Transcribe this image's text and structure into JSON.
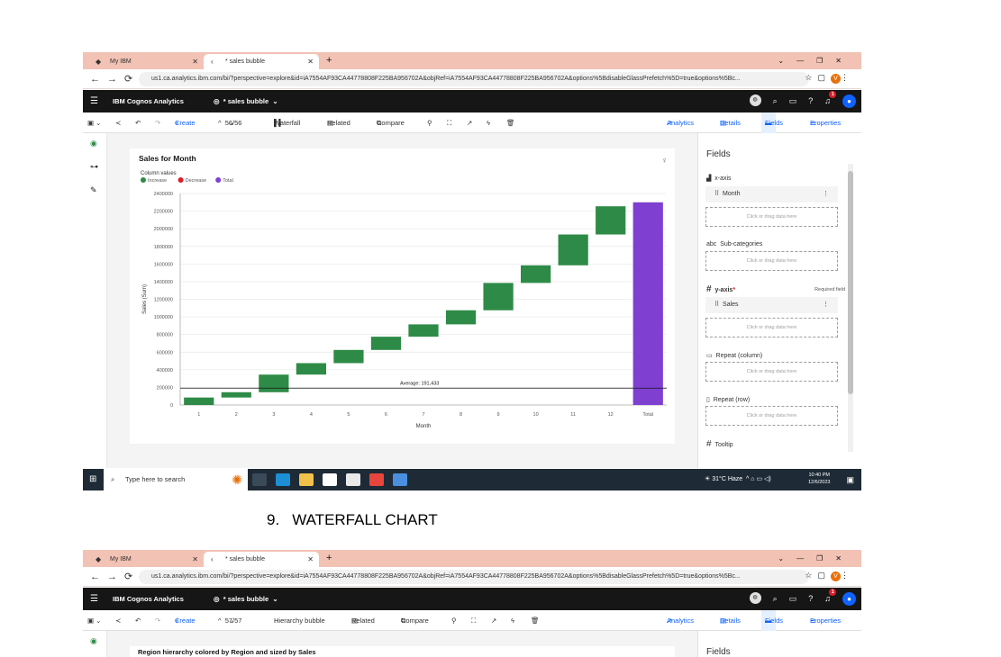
{
  "browser": {
    "tabs": [
      {
        "label": "My IBM"
      },
      {
        "label": "* sales bubble"
      }
    ],
    "url": "us1.ca.analytics.ibm.com/bi/?perspective=explore&id=iA7554AF93CA44778808F225BA956702A&objRef=iA7554AF93CA44778808F225BA956702A&options%5BdisableGlassPrefetch%5D=true&options%5Bc..."
  },
  "app": {
    "brand": "IBM Cognos Analytics",
    "report_title": "* sales bubble",
    "notification_count": "1",
    "avatar_initial": "V"
  },
  "toolbar1": {
    "create": "Create",
    "page": "56/56",
    "viz": "Waterfall",
    "related": "Related",
    "compare": "Compare",
    "analytics": "Analytics",
    "details": "Details",
    "fields": "Fields",
    "properties": "Properties"
  },
  "chart_card": {
    "title": "Sales for Month",
    "legend_title": "Column values",
    "legend": [
      {
        "label": "Increase",
        "color": "#2e8b47"
      },
      {
        "label": "Decrease",
        "color": "#da1e28"
      },
      {
        "label": "Total",
        "color": "#7f3fd1"
      }
    ],
    "average_label": "Average: 191,433"
  },
  "chart_data": {
    "type": "bar",
    "subtype": "waterfall",
    "title": "Sales for Month",
    "xlabel": "Month",
    "ylabel": "Sales (Sum)",
    "categories": [
      "1",
      "2",
      "3",
      "4",
      "5",
      "6",
      "7",
      "8",
      "9",
      "10",
      "11",
      "12",
      "Total"
    ],
    "values": [
      85000,
      60000,
      200000,
      130000,
      150000,
      150000,
      140000,
      160000,
      310000,
      200000,
      350000,
      320000,
      2300000
    ],
    "kinds": [
      "increase",
      "increase",
      "increase",
      "increase",
      "increase",
      "increase",
      "increase",
      "increase",
      "increase",
      "increase",
      "increase",
      "increase",
      "total"
    ],
    "average": 191433,
    "ylim": [
      0,
      2400000
    ],
    "yticks": [
      "0",
      "200000",
      "400000",
      "600000",
      "800000",
      "1000000",
      "1200000",
      "1400000",
      "1600000",
      "1800000",
      "2000000",
      "2200000",
      "2400000"
    ],
    "grid": true,
    "legend_position": "top-left",
    "colors": {
      "increase": "#2e8b47",
      "decrease": "#da1e28",
      "total": "#7f3fd1"
    }
  },
  "fields_panel": {
    "title": "Fields",
    "xaxis_label": "x-axis",
    "xaxis_field": "Month",
    "drop_hint": "Click or drag data here",
    "subcat_label": "Sub-categories",
    "yaxis_label": "y-axis",
    "required_marker": "*",
    "required_text": "Required field",
    "yaxis_field": "Sales",
    "repeat_col_label": "Repeat (column)",
    "repeat_row_label": "Repeat (row)",
    "tooltip_label": "Tooltip"
  },
  "taskbar": {
    "search_placeholder": "Type here to search",
    "weather": "31°C  Haze",
    "time": "10:40 PM",
    "date": "12/6/2023"
  },
  "caption": {
    "number": "9.",
    "text": "WATERFALL CHART"
  },
  "toolbar2": {
    "page": "57/57",
    "viz": "Hierarchy bubble",
    "chart_title": "Region hierarchy colored by Region and sized by Sales"
  }
}
